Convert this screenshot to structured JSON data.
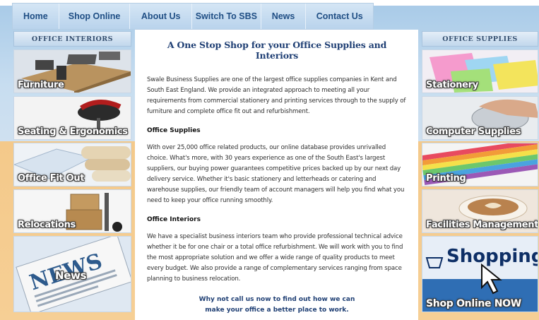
{
  "nav": {
    "items": [
      "Home",
      "Shop Online",
      "About Us",
      "Switch To SBS",
      "News",
      "Contact Us"
    ]
  },
  "left_sidebar": {
    "header": "OFFICE INTERIORS",
    "tiles": [
      "Furniture",
      "Seating & Ergonomics",
      "Office Fit Out",
      "Relocations",
      "News"
    ]
  },
  "right_sidebar": {
    "header": "OFFICE SUPPLIES",
    "tiles": [
      "Stationery",
      "Computer Supplies",
      "Printing",
      "Facilities Management",
      "Shop Online NOW"
    ],
    "shopping_banner_word": "Shopping"
  },
  "main": {
    "title": "A One Stop Shop for your Office Supplies and Interiors",
    "intro": "Swale Business Supplies are one of the largest office supplies companies in Kent and South East England. We provide an integrated approach to meeting all your requirements from commercial stationery and printing services through to the supply of furniture and complete office fit out and refurbishment.",
    "supplies_heading": "Office Supplies",
    "supplies_text": "With over 25,000 office related products, our online database provides unrivalled choice. What's more, with 30 years experience as one of the South East's largest suppliers, our buying power guarantees competitive prices backed up by our next day delivery service. Whether it's basic stationery and letterheads or catering and warehouse supplies, our friendly team of account managers will help you find what you need to keep your office running smoothly.",
    "interiors_heading": "Office Interiors",
    "interiors_text": "We have a specialist business interiors team who provide professional technical advice whether it be for one chair or a total office refurbishment. We will work with you to find the most appropriate solution and we offer a wide range of quality products to meet every budget.  We also provide a range of complementary services ranging from space planning to business relocation.",
    "cta_line1": "Why not call us now to find out how we can",
    "cta_line2": "make your office a better place to work."
  }
}
